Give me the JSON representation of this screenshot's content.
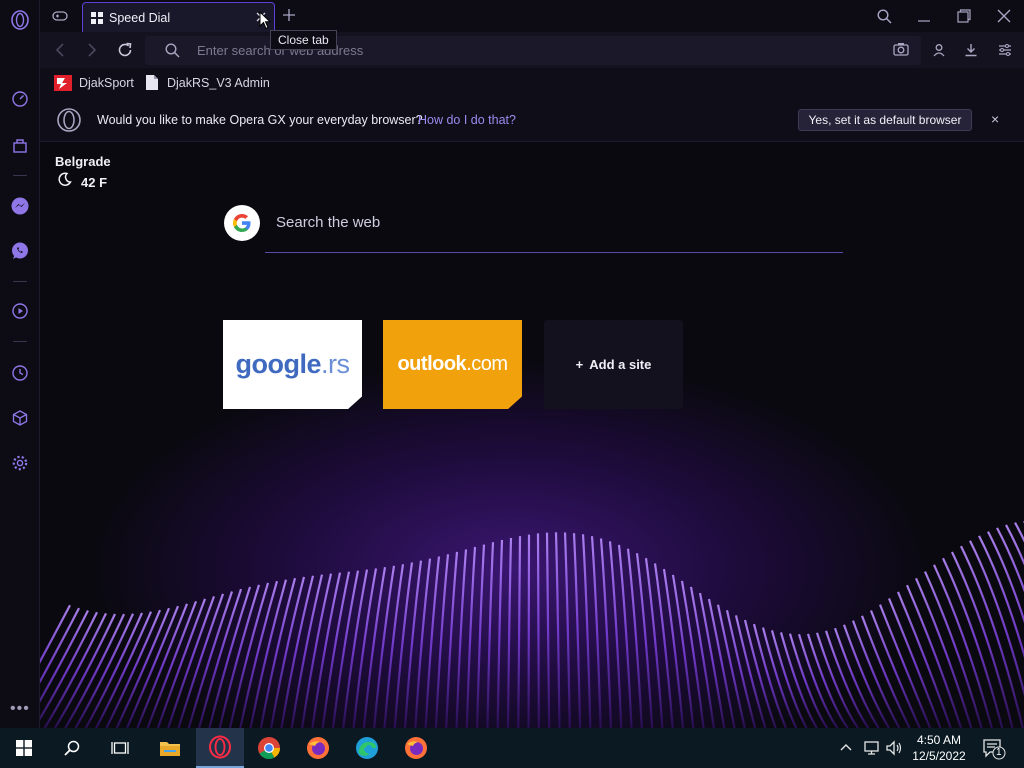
{
  "tab": {
    "title": "Speed Dial",
    "close_tooltip": "Close tab"
  },
  "addressbar": {
    "placeholder": "Enter search or web address"
  },
  "bookmarks": [
    {
      "label": "DjakSport"
    },
    {
      "label": "DjakRS_V3 Admin"
    }
  ],
  "banner": {
    "message": "Would you like to make Opera GX your everyday browser?",
    "link": "How do I do that?",
    "button": "Yes, set it as default browser",
    "close": "×"
  },
  "weather": {
    "city": "Belgrade",
    "temp": "42 F"
  },
  "search": {
    "label": "Search the web"
  },
  "speed_dial": [
    {
      "name": "google",
      "ext": ".rs"
    },
    {
      "name": "outlook",
      "ext": ".com"
    },
    {
      "add_label": "Add a site",
      "plus": "+"
    }
  ],
  "taskbar": {
    "time": "4:50 AM",
    "date": "12/5/2022",
    "notification_count": "1"
  },
  "colors": {
    "accent": "#7b5cf0",
    "outlook": "#f1a10c",
    "taskbar": "#0a1922"
  }
}
